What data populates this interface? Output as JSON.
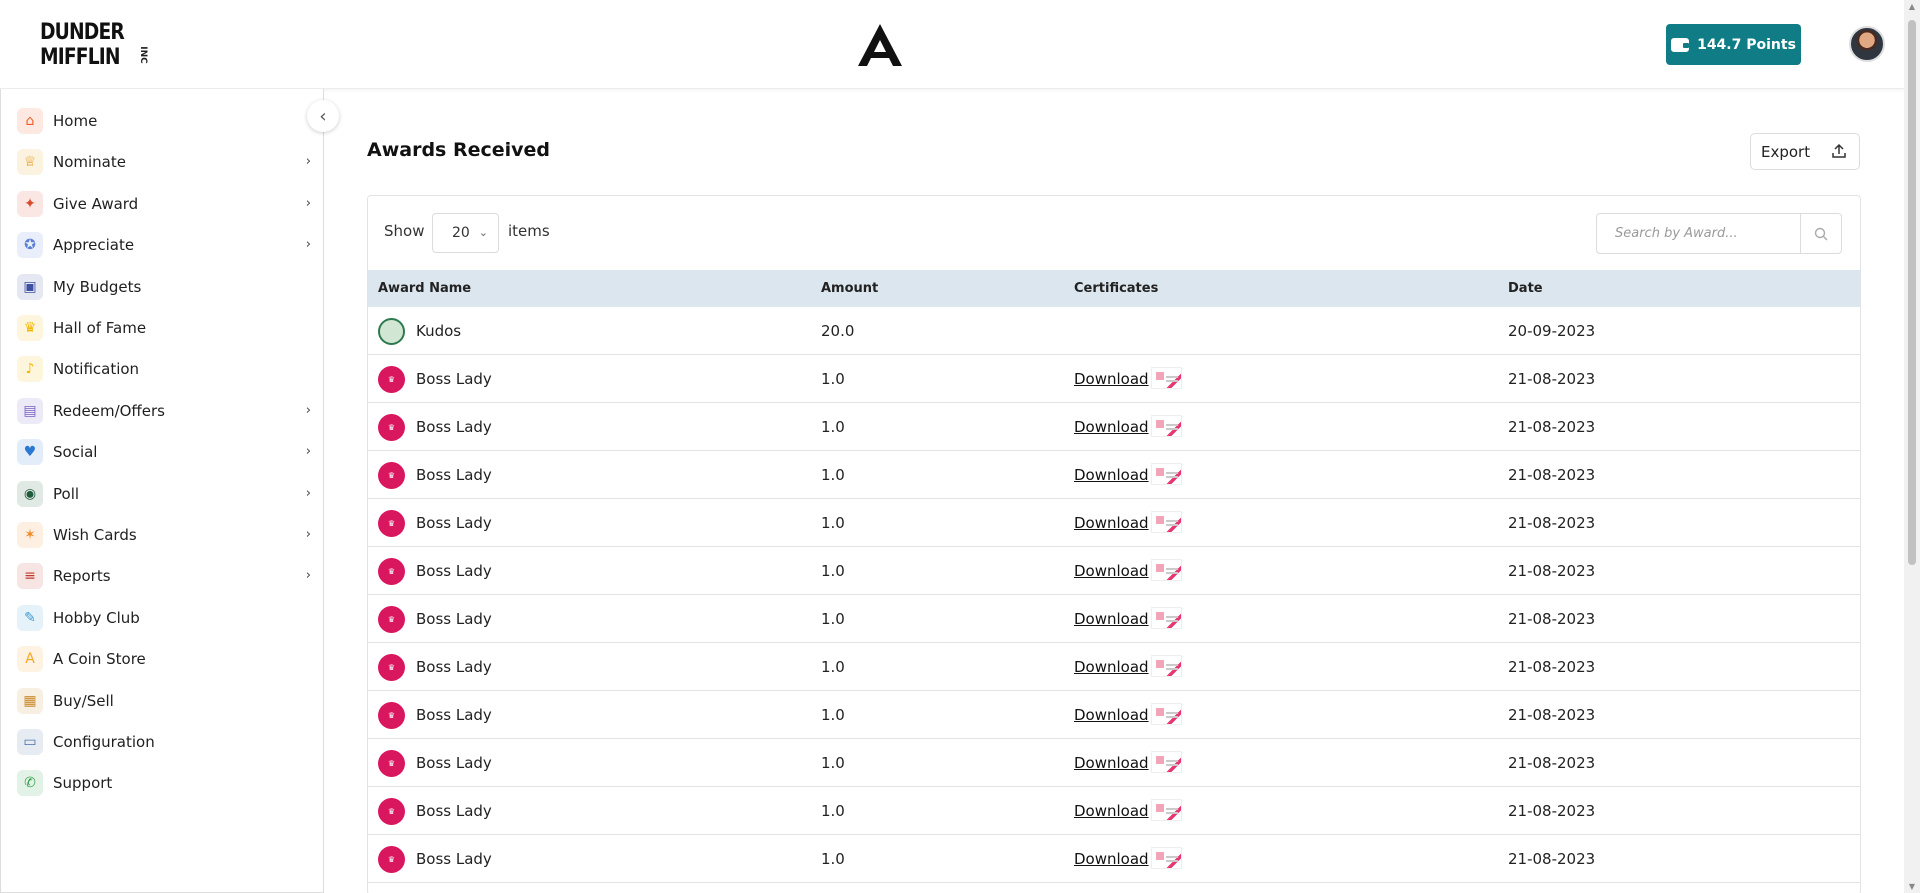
{
  "header": {
    "logo_lines": [
      "DUNDER",
      "MIFFLIN"
    ],
    "logo_suffix": "INC",
    "points_label": "144.7  Points"
  },
  "sidebar": {
    "items": [
      {
        "label": "Home",
        "icon": "home-icon",
        "chevron": false,
        "color": "#f15a24"
      },
      {
        "label": "Nominate",
        "icon": "trophy-icon",
        "chevron": true,
        "color": "#e89a1a"
      },
      {
        "label": "Give Award",
        "icon": "gift-icon",
        "chevron": true,
        "color": "#d94a2c"
      },
      {
        "label": "Appreciate",
        "icon": "medal-icon",
        "chevron": true,
        "color": "#5a7fd6"
      },
      {
        "label": "My Budgets",
        "icon": "wallet-icon",
        "chevron": false,
        "color": "#3d4fa1"
      },
      {
        "label": "Hall of Fame",
        "icon": "crown-icon",
        "chevron": false,
        "color": "#f2b705"
      },
      {
        "label": "Notification",
        "icon": "bell-icon",
        "chevron": false,
        "color": "#f4b400"
      },
      {
        "label": "Redeem/Offers",
        "icon": "gift-card-icon",
        "chevron": true,
        "color": "#7b5ec6"
      },
      {
        "label": "Social",
        "icon": "like-icon",
        "chevron": true,
        "color": "#2a78d2"
      },
      {
        "label": "Poll",
        "icon": "poll-icon",
        "chevron": true,
        "color": "#1f5c3a"
      },
      {
        "label": "Wish Cards",
        "icon": "party-popper-icon",
        "chevron": true,
        "color": "#f08a24"
      },
      {
        "label": "Reports",
        "icon": "clipboard-icon",
        "chevron": true,
        "color": "#c0392b"
      },
      {
        "label": "Hobby Club",
        "icon": "palette-icon",
        "chevron": false,
        "color": "#3c9ad6"
      },
      {
        "label": "A Coin Store",
        "icon": "coin-icon",
        "chevron": false,
        "color": "#f5a623"
      },
      {
        "label": "Buy/Sell",
        "icon": "shopping-bag-icon",
        "chevron": false,
        "color": "#c98a2c"
      },
      {
        "label": "Configuration",
        "icon": "monitor-settings-icon",
        "chevron": false,
        "color": "#4a6fa5"
      },
      {
        "label": "Support",
        "icon": "phone-icon",
        "chevron": false,
        "color": "#2e9e45"
      }
    ]
  },
  "main": {
    "title": "Awards Received",
    "export_label": "Export",
    "show_label": "Show",
    "show_value": "20",
    "items_label": "items",
    "search_placeholder": "Search by Award...",
    "columns": {
      "award_name": "Award Name",
      "amount": "Amount",
      "certificates": "Certificates",
      "date": "Date"
    },
    "rows": [
      {
        "award": "Kudos",
        "icon": "kudos",
        "amount": "20.0",
        "certificate": "",
        "date": "20-09-2023"
      },
      {
        "award": "Boss Lady",
        "icon": "boss-lady",
        "amount": "1.0",
        "certificate": "Download",
        "date": "21-08-2023"
      },
      {
        "award": "Boss Lady",
        "icon": "boss-lady",
        "amount": "1.0",
        "certificate": "Download",
        "date": "21-08-2023"
      },
      {
        "award": "Boss Lady",
        "icon": "boss-lady",
        "amount": "1.0",
        "certificate": "Download",
        "date": "21-08-2023"
      },
      {
        "award": "Boss Lady",
        "icon": "boss-lady",
        "amount": "1.0",
        "certificate": "Download",
        "date": "21-08-2023"
      },
      {
        "award": "Boss Lady",
        "icon": "boss-lady",
        "amount": "1.0",
        "certificate": "Download",
        "date": "21-08-2023"
      },
      {
        "award": "Boss Lady",
        "icon": "boss-lady",
        "amount": "1.0",
        "certificate": "Download",
        "date": "21-08-2023"
      },
      {
        "award": "Boss Lady",
        "icon": "boss-lady",
        "amount": "1.0",
        "certificate": "Download",
        "date": "21-08-2023"
      },
      {
        "award": "Boss Lady",
        "icon": "boss-lady",
        "amount": "1.0",
        "certificate": "Download",
        "date": "21-08-2023"
      },
      {
        "award": "Boss Lady",
        "icon": "boss-lady",
        "amount": "1.0",
        "certificate": "Download",
        "date": "21-08-2023"
      },
      {
        "award": "Boss Lady",
        "icon": "boss-lady",
        "amount": "1.0",
        "certificate": "Download",
        "date": "21-08-2023"
      },
      {
        "award": "Boss Lady",
        "icon": "boss-lady",
        "amount": "1.0",
        "certificate": "Download",
        "date": "21-08-2023"
      }
    ]
  },
  "colors": {
    "primary": "#0f7c86",
    "table_header": "#dce6ef",
    "award_pink": "#d8175f"
  }
}
